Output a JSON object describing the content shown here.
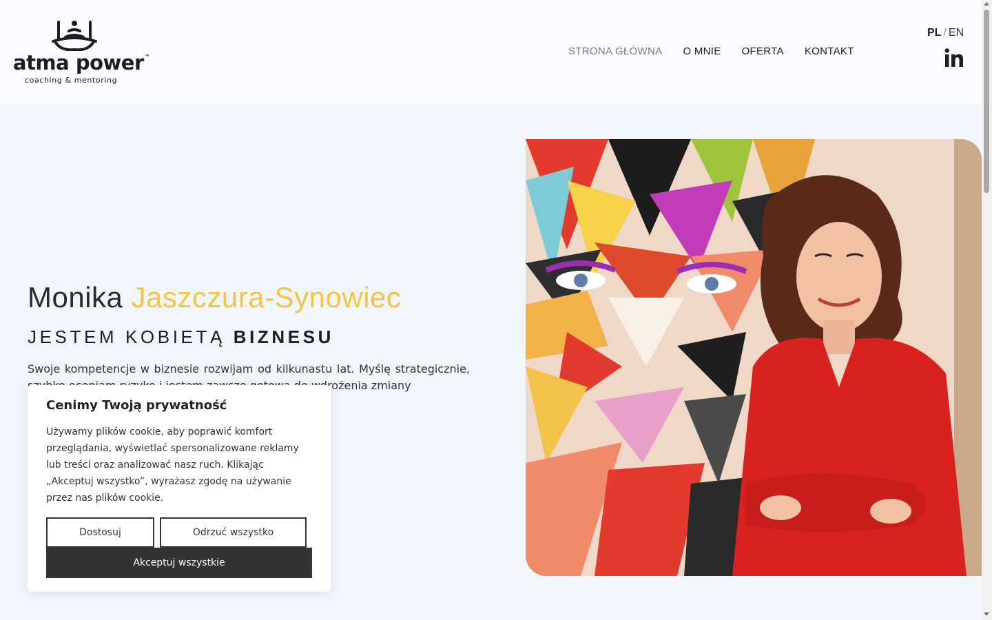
{
  "brand": {
    "name": "atma power",
    "trademark": "™",
    "tagline": "coaching & mentoring"
  },
  "nav": {
    "items": [
      {
        "label": "STRONA GŁÓWNA",
        "active": true
      },
      {
        "label": "O MNIE",
        "active": false
      },
      {
        "label": "OFERTA",
        "active": false
      },
      {
        "label": "KONTAKT",
        "active": false
      }
    ]
  },
  "lang": {
    "pl": "PL",
    "separator": "/",
    "en": "EN"
  },
  "social": {
    "linkedin_icon": "linkedin-icon"
  },
  "hero": {
    "first_name": "Monika",
    "last_name": "Jaszczura-Synowiec",
    "tagline_light": "JESTEM KOBIETĄ",
    "tagline_bold": "BIZNESU",
    "description": "Swoje kompetencje w biznesie rozwijam od kilkunastu lat. Myślę strategicznie, szybko oceniam ryzyko i jestem zawsze gotowa do wdrożenia zmiany"
  },
  "cookie": {
    "title": "Cenimy Twoją prywatność",
    "text": "Używamy plików cookie, aby poprawić komfort przeglądania, wyświetlać spersonalizowane reklamy lub treści oraz analizować nasz ruch. Klikając „Akceptuj wszystko”, wyrażasz zgodę na używanie przez nas plików cookie.",
    "customize_label": "Dostosuj",
    "reject_label": "Odrzuć wszystko",
    "accept_label": "Akceptuj wszystkie"
  },
  "colors": {
    "accent": "#f4c542",
    "dark": "#333333",
    "background": "#f1f5fc"
  }
}
